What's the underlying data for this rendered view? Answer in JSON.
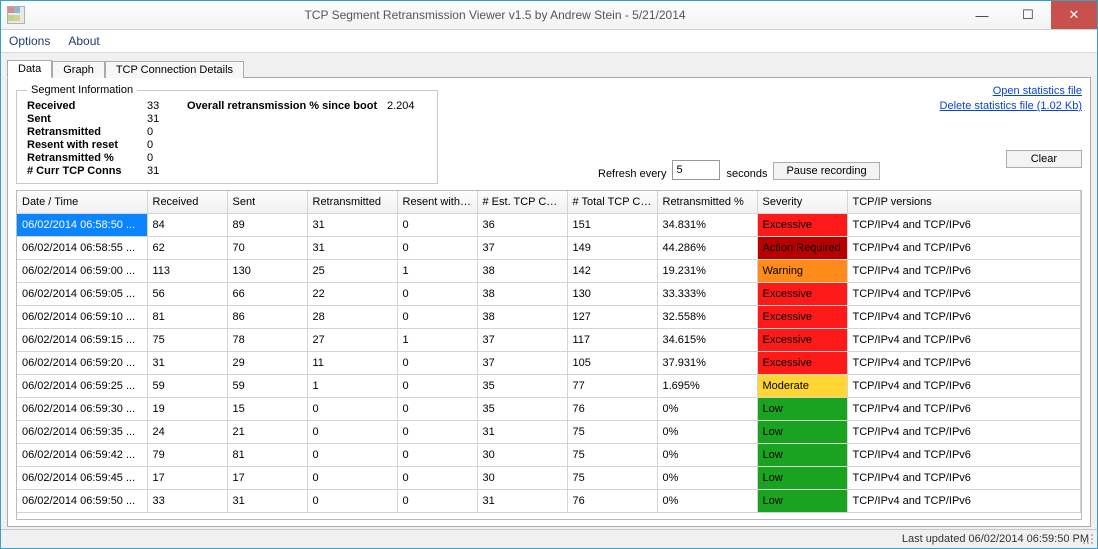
{
  "window": {
    "title": "TCP Segment Retransmission Viewer v1.5 by Andrew Stein - 5/21/2014"
  },
  "menu": {
    "options": "Options",
    "about": "About"
  },
  "tabs": {
    "data": "Data",
    "graph": "Graph",
    "details": "TCP Connection Details"
  },
  "segment": {
    "legend": "Segment Information",
    "received_lbl": "Received",
    "received": "33",
    "sent_lbl": "Sent",
    "sent": "31",
    "retransmitted_lbl": "Retransmitted",
    "retransmitted": "0",
    "resent_reset_lbl": "Resent with reset",
    "resent_reset": "0",
    "retransmitted_pct_lbl": "Retransmitted %",
    "retransmitted_pct": "0",
    "curr_conns_lbl": "# Curr TCP Conns",
    "curr_conns": "31",
    "overall_lbl": "Overall retransmission % since boot",
    "overall": "2.204"
  },
  "controls": {
    "refresh_pre": "Refresh every",
    "refresh_value": "5",
    "refresh_post": "seconds",
    "pause": "Pause recording",
    "clear": "Clear"
  },
  "links": {
    "open": "Open statistics file",
    "delete": "Delete statistics file (1.02 Kb)"
  },
  "columns": {
    "datetime": "Date / Time",
    "received": "Received",
    "sent": "Sent",
    "retransmitted": "Retransmitted",
    "resent_reset": "Resent with reset",
    "est_conn": "# Est. TCP Connections",
    "total_conn": "# Total TCP Conn",
    "retransmitted_pct": "Retransmitted %",
    "severity": "Severity",
    "tcpip": "TCP/IP versions"
  },
  "severity_labels": {
    "excessive": "Excessive",
    "action": "Action Required",
    "warning": "Warning",
    "moderate": "Moderate",
    "low": "Low"
  },
  "tcpip_value": "TCP/IPv4 and TCP/IPv6",
  "rows": [
    {
      "dt": "06/02/2014 06:58:50 ...",
      "rx": "84",
      "tx": "89",
      "rt": "31",
      "rr": "0",
      "est": "36",
      "tot": "151",
      "pct": "34.831%",
      "sev": "excessive",
      "sel": true
    },
    {
      "dt": "06/02/2014 06:58:55 ...",
      "rx": "62",
      "tx": "70",
      "rt": "31",
      "rr": "0",
      "est": "37",
      "tot": "149",
      "pct": "44.286%",
      "sev": "action"
    },
    {
      "dt": "06/02/2014 06:59:00 ...",
      "rx": "113",
      "tx": "130",
      "rt": "25",
      "rr": "1",
      "est": "38",
      "tot": "142",
      "pct": "19.231%",
      "sev": "warning"
    },
    {
      "dt": "06/02/2014 06:59:05 ...",
      "rx": "56",
      "tx": "66",
      "rt": "22",
      "rr": "0",
      "est": "38",
      "tot": "130",
      "pct": "33.333%",
      "sev": "excessive"
    },
    {
      "dt": "06/02/2014 06:59:10 ...",
      "rx": "81",
      "tx": "86",
      "rt": "28",
      "rr": "0",
      "est": "38",
      "tot": "127",
      "pct": "32.558%",
      "sev": "excessive"
    },
    {
      "dt": "06/02/2014 06:59:15 ...",
      "rx": "75",
      "tx": "78",
      "rt": "27",
      "rr": "1",
      "est": "37",
      "tot": "117",
      "pct": "34.615%",
      "sev": "excessive"
    },
    {
      "dt": "06/02/2014 06:59:20 ...",
      "rx": "31",
      "tx": "29",
      "rt": "11",
      "rr": "0",
      "est": "37",
      "tot": "105",
      "pct": "37.931%",
      "sev": "excessive"
    },
    {
      "dt": "06/02/2014 06:59:25 ...",
      "rx": "59",
      "tx": "59",
      "rt": "1",
      "rr": "0",
      "est": "35",
      "tot": "77",
      "pct": "1.695%",
      "sev": "moderate"
    },
    {
      "dt": "06/02/2014 06:59:30 ...",
      "rx": "19",
      "tx": "15",
      "rt": "0",
      "rr": "0",
      "est": "35",
      "tot": "76",
      "pct": "0%",
      "sev": "low"
    },
    {
      "dt": "06/02/2014 06:59:35 ...",
      "rx": "24",
      "tx": "21",
      "rt": "0",
      "rr": "0",
      "est": "31",
      "tot": "75",
      "pct": "0%",
      "sev": "low"
    },
    {
      "dt": "06/02/2014 06:59:42 ...",
      "rx": "79",
      "tx": "81",
      "rt": "0",
      "rr": "0",
      "est": "30",
      "tot": "75",
      "pct": "0%",
      "sev": "low"
    },
    {
      "dt": "06/02/2014 06:59:45 ...",
      "rx": "17",
      "tx": "17",
      "rt": "0",
      "rr": "0",
      "est": "30",
      "tot": "75",
      "pct": "0%",
      "sev": "low"
    },
    {
      "dt": "06/02/2014 06:59:50 ...",
      "rx": "33",
      "tx": "31",
      "rt": "0",
      "rr": "0",
      "est": "31",
      "tot": "76",
      "pct": "0%",
      "sev": "low"
    }
  ],
  "status": {
    "last_updated": "Last updated 06/02/2014 06:59:50 PM"
  }
}
